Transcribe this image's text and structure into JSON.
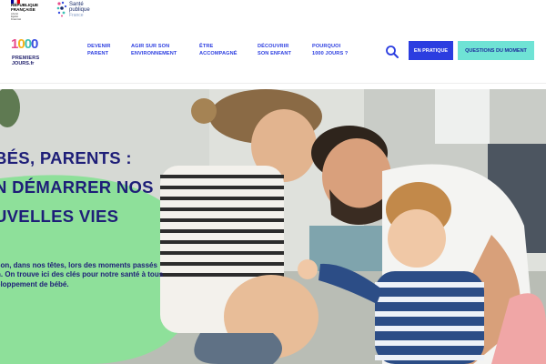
{
  "top_logos": {
    "republic": [
      "RÉPUBLIQUE",
      "FRANÇAISE"
    ],
    "republic_motto": [
      "Liberté",
      "Égalité",
      "Fraternité"
    ],
    "sante_publique": [
      "Santé",
      "publique"
    ],
    "sante_publique_sub": "France"
  },
  "brand": {
    "digits": [
      "1",
      "0",
      "0",
      "0"
    ],
    "line1": "PREMIERS",
    "line2": "JOURS.fr"
  },
  "nav": {
    "items": [
      [
        "DEVENIR",
        "PARENT"
      ],
      [
        "AGIR SUR SON",
        "ENVIRONNEMENT"
      ],
      [
        "ÊTRE",
        "ACCOMPAGNÉ"
      ],
      [
        "DÉCOUVRIR",
        "SON ENFANT"
      ],
      [
        "POURQUOI",
        "1000 JOURS ?"
      ]
    ],
    "search_icon": "search-icon",
    "en_pratique": "EN PRATIQUE",
    "questions": "QUESTIONS DU MOMENT"
  },
  "hero": {
    "title_lines": [
      "BÉS, PARENTS :",
      "N DÉMARRER NOS",
      "UVELLES VIES"
    ],
    "text_lines": [
      "son, dans nos têtes, lors des moments passés",
      "n. On trouve ici des clés pour notre santé à tous",
      "eloppement de bébé."
    ]
  },
  "colors": {
    "primary_blue": "#2b3de0",
    "navy": "#1e1e78",
    "mint": "#6fe3d5",
    "hero_green": "#8ee09a"
  }
}
